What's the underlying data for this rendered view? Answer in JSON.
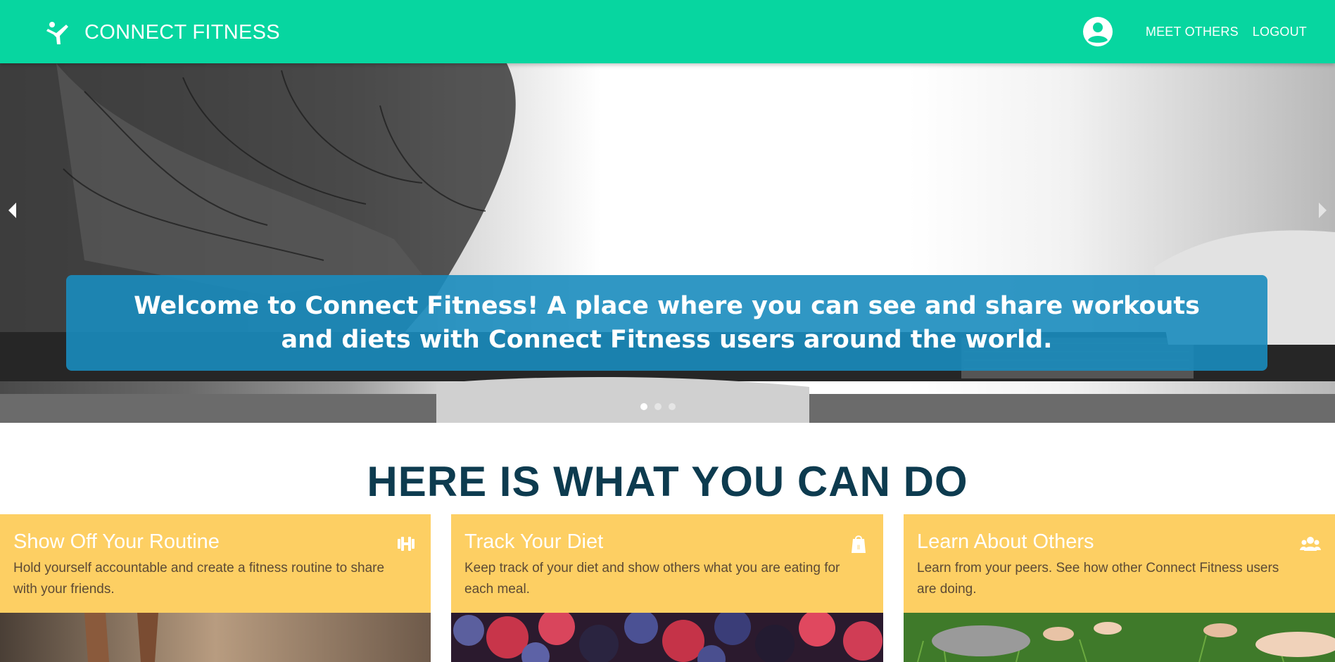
{
  "nav": {
    "brand": "CONNECT FITNESS",
    "brand_icon": "runner-logo-icon",
    "profile_icon": "account-circle-icon",
    "links": [
      "MEET OTHERS",
      "LOGOUT"
    ],
    "color": "#07d6a0"
  },
  "hero": {
    "caption": "Welcome to Connect Fitness! A place where you can see and share workouts and diets with Connect Fitness users around the world.",
    "slides_total": 3,
    "active_slide": 1,
    "caption_color": "#198cbe"
  },
  "features": {
    "title": "HERE IS WHAT YOU CAN DO",
    "cards": [
      {
        "title": "Show Off Your Routine",
        "description": "Hold yourself accountable and create a fitness routine to share with your friends.",
        "icon": "dumbbell-icon"
      },
      {
        "title": "Track Your Diet",
        "description": "Keep track of your diet and show others what you are eating for each meal.",
        "icon": "food-bag-icon"
      },
      {
        "title": "Learn About Others",
        "description": "Learn from your peers. See how other Connect Fitness users are doing.",
        "icon": "group-icon"
      }
    ],
    "card_color": "#fdcf63"
  }
}
